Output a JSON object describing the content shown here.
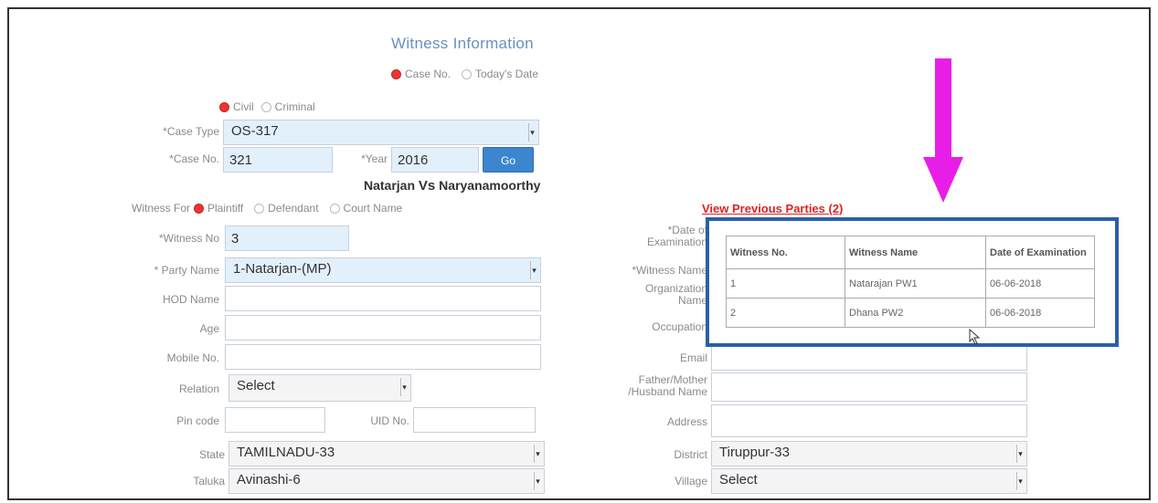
{
  "form": {
    "title": "Witness Information",
    "search_mode": {
      "case_no": "Case No.",
      "todays_date": "Today's Date",
      "selected": "case_no"
    },
    "case_category": {
      "civil": "Civil",
      "criminal": "Criminal",
      "selected": "civil"
    },
    "case_type": {
      "label": "*Case Type",
      "value": "OS-317"
    },
    "case_no": {
      "label": "*Case No.",
      "value": "321"
    },
    "year": {
      "label": "*Year",
      "value": "2016"
    },
    "go_label": "Go",
    "parties": {
      "petitioner": "Natarjan",
      "vs": "Vs",
      "respondent": "Naryanamoorthy"
    },
    "witness_for": {
      "label": "Witness For",
      "plaintiff": "Plaintiff",
      "defendant": "Defendant",
      "court_name": "Court Name",
      "selected": "plaintiff"
    },
    "witness_no": {
      "label": "*Witness No",
      "value": "3"
    },
    "party_name": {
      "label": "* Party Name",
      "value": "1-Natarjan-(MP)"
    },
    "hod_name": {
      "label": "HOD Name",
      "value": ""
    },
    "age": {
      "label": "Age",
      "value": ""
    },
    "mobile_no": {
      "label": "Mobile No.",
      "value": ""
    },
    "relation": {
      "label": "Relation",
      "value": "Select"
    },
    "pin_code": {
      "label": "Pin code",
      "value": ""
    },
    "uid_no": {
      "label": "UID No.",
      "value": ""
    },
    "state": {
      "label": "State",
      "value": "TAMILNADU-33"
    },
    "taluka": {
      "label": "Taluka",
      "value": "Avinashi-6"
    },
    "date_of_examination": {
      "label_line1": "*Date of",
      "label_line2": "Examination"
    },
    "witness_name": {
      "label": "*Witness Name"
    },
    "organization": {
      "label_line1": "Organization",
      "label_line2": "Name"
    },
    "occupation": {
      "label": "Occupation"
    },
    "email": {
      "label": "Email",
      "value": ""
    },
    "father_mother": {
      "label_line1": "Father/Mother",
      "label_line2": "/Husband Name",
      "value": ""
    },
    "address": {
      "label": "Address",
      "value": ""
    },
    "district": {
      "label": "District",
      "value": "Tiruppur-33"
    },
    "village": {
      "label": "Village",
      "value": "Select"
    }
  },
  "previous_parties": {
    "link_label": "View Previous Parties (2)",
    "headers": [
      "Witness No.",
      "Witness Name",
      "Date of Examination"
    ],
    "rows": [
      [
        "1",
        "Natarajan PW1",
        "06-06-2018"
      ],
      [
        "2",
        "Dhana PW2",
        "06-06-2018"
      ]
    ]
  },
  "colors": {
    "annotation_arrow": "#e81ee8",
    "overlay_border": "#2b5fa8",
    "go_button": "#3c86cf",
    "link_red": "#dd2222"
  }
}
